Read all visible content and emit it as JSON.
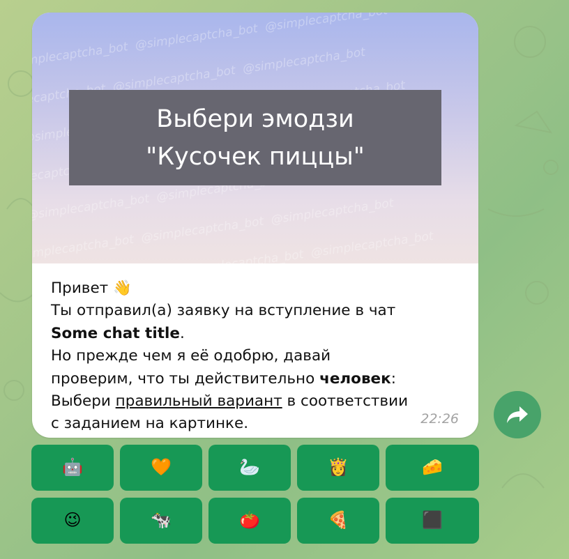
{
  "colors": {
    "keyboard_button": "#179855",
    "share_button": "#48a36a",
    "bubble": "#ffffff",
    "caption_box": "#676670"
  },
  "captcha": {
    "watermark_text": "@simplecaptcha_bot",
    "caption_line1": "Выбери эмодзи",
    "caption_line2": "\"Кусочек пиццы\""
  },
  "message": {
    "greeting": "Привет",
    "greeting_emoji": "👋",
    "line2": "Ты отправил(а) заявку на вступление в чат",
    "chat_title": "Some chat title",
    "chat_title_suffix": ".",
    "line4": "Но прежде чем я её одобрю, давай",
    "line5_prefix": "проверим, что ты действительно ",
    "line5_bold": "человек",
    "line5_suffix": ":",
    "line6_prefix": "Выбери ",
    "line6_underline": "правильный вариант",
    "line6_suffix": " в соответствии",
    "line7": "с заданием на картинке.",
    "time": "22:26"
  },
  "share_button": {
    "icon": "share-arrow-icon"
  },
  "keyboard": {
    "row1": [
      "🤖",
      "🧡",
      "🦢",
      "👸",
      "🧀"
    ],
    "row2": [
      "😉",
      "🐄",
      "🍅",
      "🍕",
      "⬛"
    ]
  }
}
